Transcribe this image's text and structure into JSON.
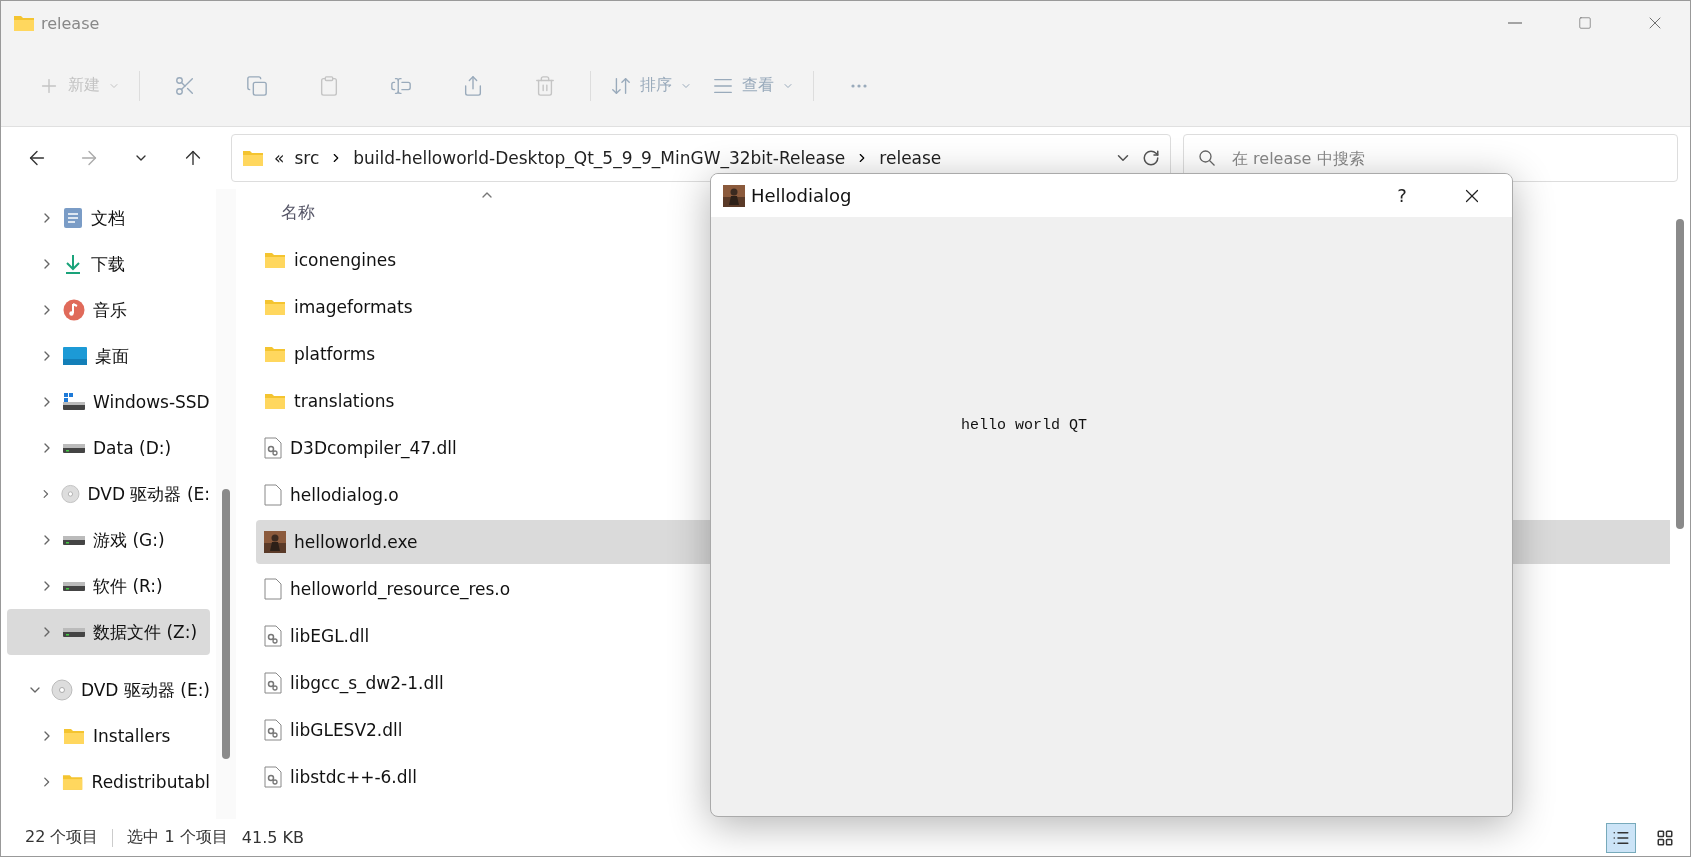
{
  "window": {
    "title": "release"
  },
  "toolbar": [
    {
      "kind": "new",
      "label": "新建",
      "disabled": true
    },
    {
      "kind": "cut",
      "disabled": false
    },
    {
      "kind": "copy",
      "disabled": false
    },
    {
      "kind": "paste",
      "disabled": true
    },
    {
      "kind": "rename",
      "disabled": false
    },
    {
      "kind": "share",
      "disabled": false
    },
    {
      "kind": "delete",
      "disabled": true
    },
    {
      "kind": "sort",
      "label": "排序",
      "disabled": false
    },
    {
      "kind": "view",
      "label": "查看",
      "disabled": false
    },
    {
      "kind": "more",
      "disabled": false
    }
  ],
  "address": {
    "overflow": "«",
    "segments": [
      "src",
      "build-helloworld-Desktop_Qt_5_9_9_MinGW_32bit-Release",
      "release"
    ]
  },
  "search": {
    "placeholder": "在 release 中搜索"
  },
  "sidebar": {
    "items": [
      {
        "label": "文档",
        "kind": "documents",
        "expanded": false,
        "selected": false
      },
      {
        "label": "下载",
        "kind": "downloads",
        "expanded": false,
        "selected": false
      },
      {
        "label": "音乐",
        "kind": "music",
        "expanded": false,
        "selected": false
      },
      {
        "label": "桌面",
        "kind": "desktop",
        "expanded": false,
        "selected": false
      },
      {
        "label": "Windows-SSD",
        "kind": "system-drive",
        "expanded": false,
        "selected": false
      },
      {
        "label": "Data (D:)",
        "kind": "drive",
        "expanded": false,
        "selected": false
      },
      {
        "label": "DVD 驱动器 (E:",
        "kind": "dvd",
        "expanded": false,
        "selected": false
      },
      {
        "label": "游戏 (G:)",
        "kind": "drive",
        "expanded": false,
        "selected": false
      },
      {
        "label": "软件 (R:)",
        "kind": "drive",
        "expanded": false,
        "selected": false
      },
      {
        "label": "数据文件 (Z:)",
        "kind": "drive",
        "expanded": false,
        "selected": true
      }
    ],
    "root_items": [
      {
        "label": "DVD 驱动器 (E:)",
        "kind": "dvd",
        "expanded": true,
        "selected": false,
        "children": [
          {
            "label": "Installers",
            "kind": "folder",
            "expanded": false,
            "selected": false
          },
          {
            "label": "Redistributabl",
            "kind": "folder",
            "expanded": false,
            "selected": false
          }
        ]
      }
    ]
  },
  "files": {
    "column": "名称",
    "rows": [
      {
        "name": "iconengines",
        "kind": "folder",
        "selected": false
      },
      {
        "name": "imageformats",
        "kind": "folder",
        "selected": false
      },
      {
        "name": "platforms",
        "kind": "folder",
        "selected": false
      },
      {
        "name": "translations",
        "kind": "folder",
        "selected": false
      },
      {
        "name": "D3Dcompiler_47.dll",
        "kind": "dll",
        "selected": false
      },
      {
        "name": "hellodialog.o",
        "kind": "file",
        "selected": false
      },
      {
        "name": "helloworld.exe",
        "kind": "exe",
        "selected": true
      },
      {
        "name": "helloworld_resource_res.o",
        "kind": "file",
        "selected": false
      },
      {
        "name": "libEGL.dll",
        "kind": "dll",
        "selected": false
      },
      {
        "name": "libgcc_s_dw2-1.dll",
        "kind": "dll",
        "selected": false
      },
      {
        "name": "libGLESV2.dll",
        "kind": "dll",
        "selected": false
      },
      {
        "name": "libstdc++-6.dll",
        "kind": "dll",
        "selected": false
      }
    ]
  },
  "status": {
    "count": "22 个项目",
    "selection": "选中 1 个项目",
    "size": "41.5 KB",
    "views": [
      {
        "kind": "details",
        "selected": true
      },
      {
        "kind": "tiles",
        "selected": false
      }
    ]
  },
  "dialog": {
    "title": "Hellodialog",
    "help": "?",
    "message": "hello world QT"
  }
}
